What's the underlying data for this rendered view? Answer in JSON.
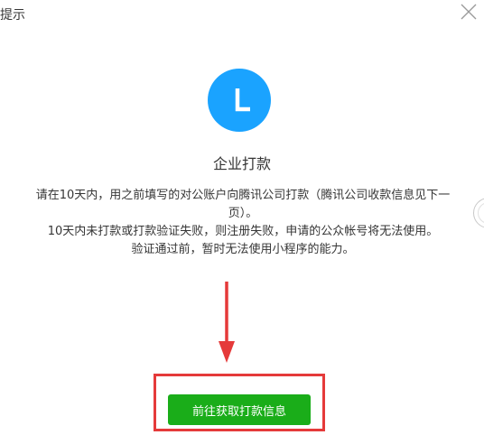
{
  "dialog": {
    "title": "提示",
    "close_icon": "close-icon"
  },
  "status": {
    "icon": "clock-icon",
    "icon_color": "#1aa3ff",
    "title": "企业打款"
  },
  "description": {
    "line1": "请在10天内，用之前填写的对公账户向腾讯公司打款（腾讯公司收款信息见下一页）。",
    "line2": "10天内未打款或打款验证失败，则注册失败，申请的公众帐号将无法使用。",
    "line3": "验证通过前，暂时无法使用小程序的能力。"
  },
  "annotation": {
    "arrow_color": "#e53a3a",
    "box_color": "#e53a3a"
  },
  "actions": {
    "primary_label": "前往获取打款信息",
    "primary_color": "#1aad19"
  }
}
